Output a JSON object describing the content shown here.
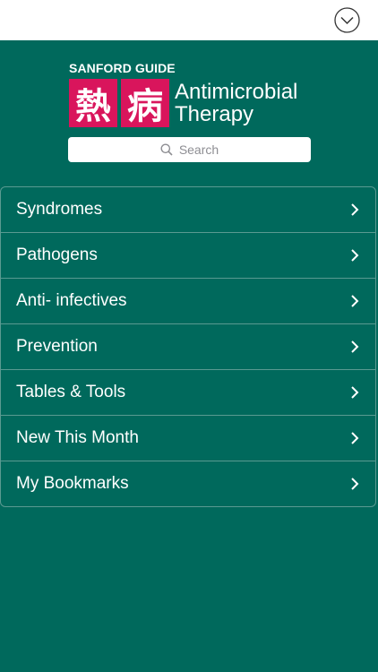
{
  "colors": {
    "background": "#00695c",
    "topbar": "#ffffff",
    "kanji_bg": "#d9155c",
    "divider": "#5a9a91"
  },
  "header": {
    "collapse_icon": "chevron-down-circle-icon"
  },
  "brand": {
    "top_label": "SANFORD GUIDE",
    "kanji": [
      "熱",
      "病"
    ],
    "title_line1": "Antimicrobial",
    "title_line2": "Therapy"
  },
  "search": {
    "placeholder": "Search",
    "icon": "search-icon"
  },
  "menu": {
    "items": [
      {
        "label": "Syndromes"
      },
      {
        "label": "Pathogens"
      },
      {
        "label": "Anti- infectives"
      },
      {
        "label": "Prevention"
      },
      {
        "label": "Tables & Tools"
      },
      {
        "label": "New This Month"
      },
      {
        "label": "My Bookmarks"
      }
    ]
  }
}
